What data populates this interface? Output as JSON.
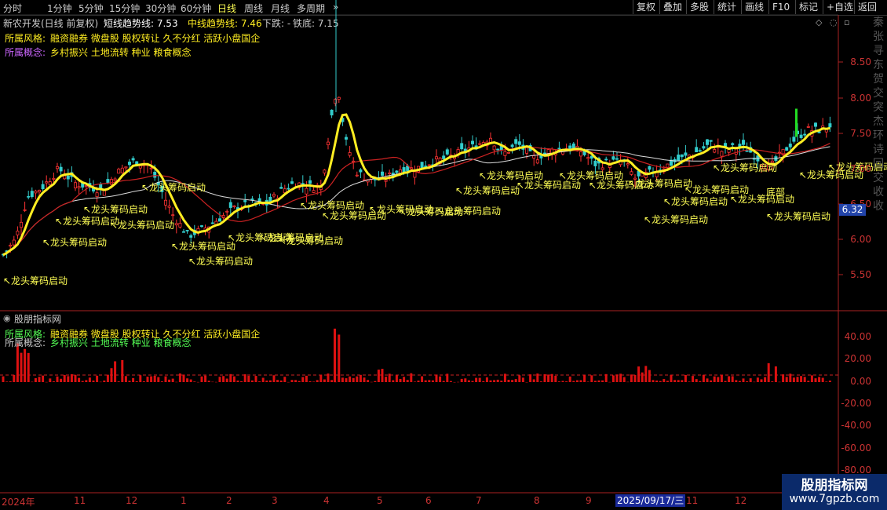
{
  "periods": [
    "分时",
    "1分钟",
    "5分钟",
    "15分钟",
    "30分钟",
    "60分钟",
    "日线",
    "周线",
    "月线",
    "多周期"
  ],
  "active_period": "日线",
  "more_arrow": "»",
  "toolbar": [
    "复权",
    "叠加",
    "多股",
    "统计",
    "画线",
    "F10",
    "标记",
    "+自选",
    "返回"
  ],
  "info": {
    "stock": "新农开发(日线 前复权)",
    "short_label": "短线趋势线: 7.53",
    "mid_label": "中线趋势线: 7.46",
    "down_label": "下跌: -",
    "iron_label": "铁底: 7.15"
  },
  "style_label": "所属风格:",
  "style_value": "融资融券 微盘股 股权转让 久不分红 活跃小盘国企",
  "concept_label": "所属概念:",
  "concept_value": "乡村振兴 土地流转 种业 粮食概念",
  "indicator_title": "股朋指标网",
  "price_axis": [
    "8.50",
    "8.00",
    "7.50",
    "7.00",
    "6.50",
    "6.00",
    "5.50"
  ],
  "current_price": "6.32",
  "ind_axis": [
    "40.00",
    "20.00",
    "0.00",
    "-20.00",
    "-40.00",
    "-60.00",
    "-80.00"
  ],
  "signal_text": "龙头筹码启动",
  "bottom_text": "底部",
  "date_labels": [
    "2024年",
    "11",
    "12",
    "1",
    "2",
    "3",
    "4",
    "5",
    "6",
    "7",
    "8",
    "9",
    "11",
    "12"
  ],
  "date_highlight": "2025/09/17/三",
  "watermark_title": "股朋指标网",
  "watermark_url": "www.7gpzb.com",
  "right_strip": "秦张寻东贺交突杰环诗回交收收",
  "colors": {
    "up": "#ff3333",
    "down": "#33cccc",
    "short": "#ffee22",
    "mid": "#cc2222",
    "long": "#dddddd",
    "accent": "#ffff55",
    "purple": "#cc66ff"
  }
}
